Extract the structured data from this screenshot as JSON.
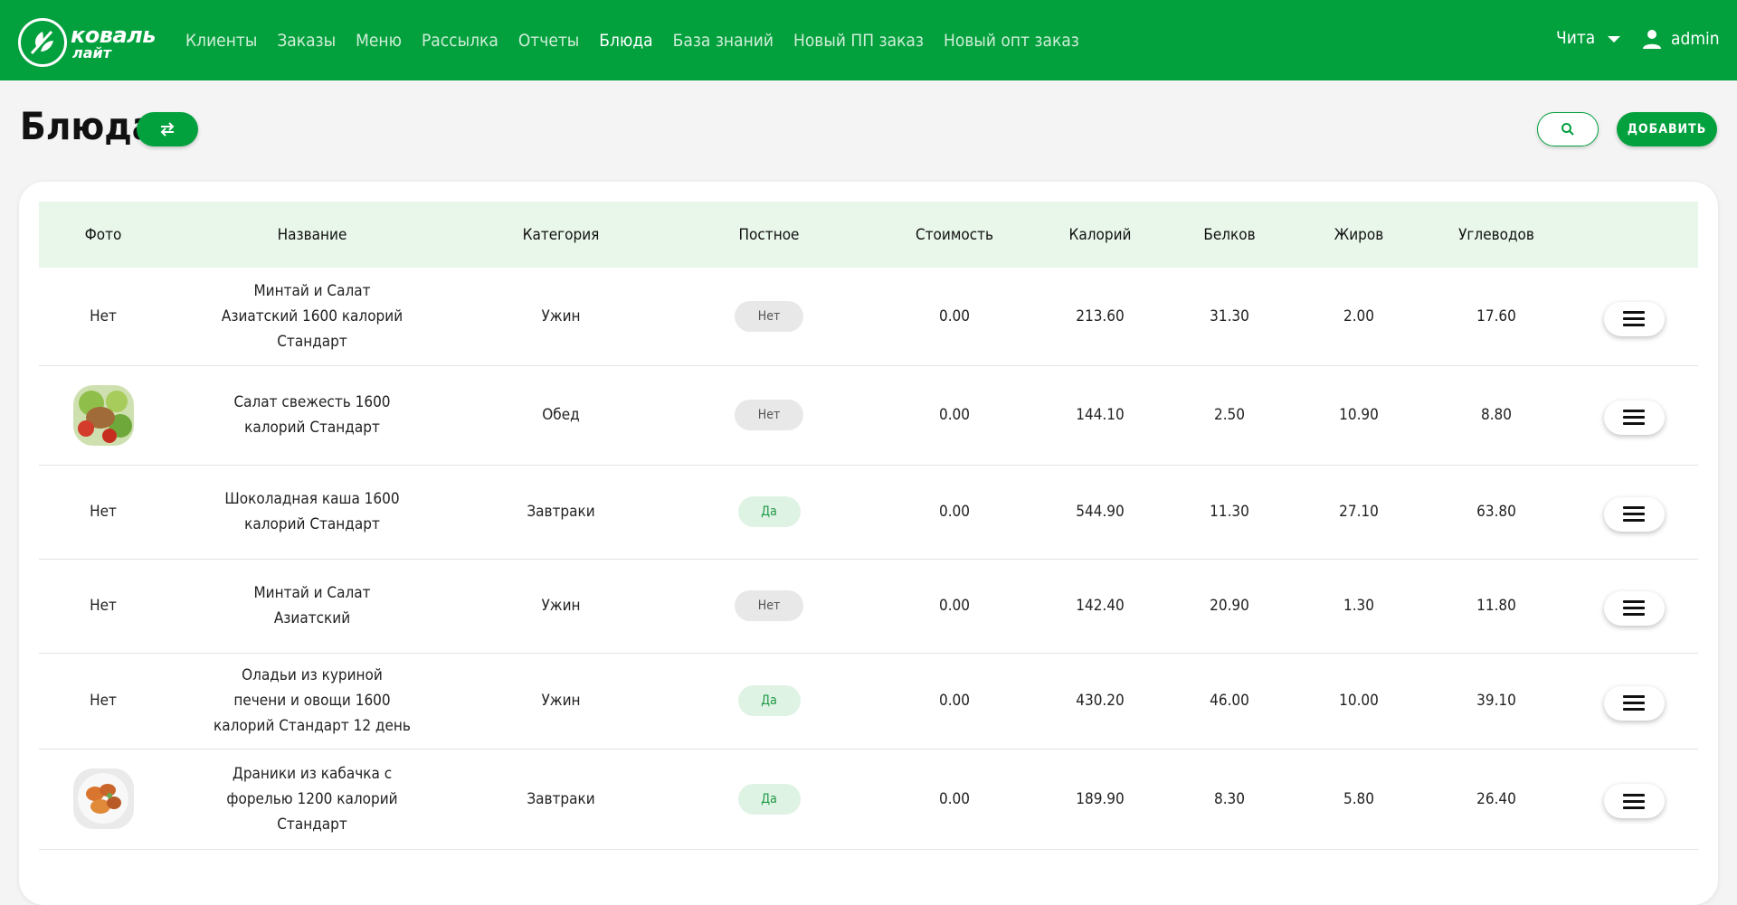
{
  "brand": {
    "line1": "коваль",
    "line2": "лайт"
  },
  "nav": [
    {
      "label": "Клиенты",
      "active": false
    },
    {
      "label": "Заказы",
      "active": false
    },
    {
      "label": "Меню",
      "active": false
    },
    {
      "label": "Рассылка",
      "active": false
    },
    {
      "label": "Отчеты",
      "active": false
    },
    {
      "label": "Блюда",
      "active": true
    },
    {
      "label": "База знаний",
      "active": false
    },
    {
      "label": "Новый ПП заказ",
      "active": false
    },
    {
      "label": "Новый опт заказ",
      "active": false
    }
  ],
  "header": {
    "city": "Чита",
    "user": "admin"
  },
  "page": {
    "title": "Блюда",
    "add_label": "ДОБАВИТЬ"
  },
  "colors": {
    "accent": "#03a03e",
    "header_row": "#e9f6ea"
  },
  "table": {
    "columns": [
      "Фото",
      "Название",
      "Категория",
      "Постное",
      "Стоимость",
      "Калорий",
      "Белков",
      "Жиров",
      "Углеводов",
      ""
    ],
    "rows": [
      {
        "photo": "Нет",
        "name": [
          "Минтай и Салат",
          "Азиатский 1600 калорий",
          "Стандарт"
        ],
        "category": "Ужин",
        "lenten": "Нет",
        "cost": "0.00",
        "calories": "213.60",
        "protein": "31.30",
        "fat": "2.00",
        "carbs": "17.60"
      },
      {
        "photo": "salad-photo",
        "name": [
          "Салат свежесть 1600",
          "калорий Стандарт"
        ],
        "category": "Обед",
        "lenten": "Нет",
        "cost": "0.00",
        "calories": "144.10",
        "protein": "2.50",
        "fat": "10.90",
        "carbs": "8.80"
      },
      {
        "photo": "Нет",
        "name": [
          "Шоколадная каша 1600",
          "калорий Стандарт"
        ],
        "category": "Завтраки",
        "lenten": "Да",
        "cost": "0.00",
        "calories": "544.90",
        "protein": "11.30",
        "fat": "27.10",
        "carbs": "63.80"
      },
      {
        "photo": "Нет",
        "name": [
          "Минтай и Салат",
          "Азиатский"
        ],
        "category": "Ужин",
        "lenten": "Нет",
        "cost": "0.00",
        "calories": "142.40",
        "protein": "20.90",
        "fat": "1.30",
        "carbs": "11.80"
      },
      {
        "photo": "Нет",
        "name": [
          "Оладьи из куриной",
          "печени и овощи 1600",
          "калорий Стандарт 12 день"
        ],
        "category": "Ужин",
        "lenten": "Да",
        "cost": "0.00",
        "calories": "430.20",
        "protein": "46.00",
        "fat": "10.00",
        "carbs": "39.10"
      },
      {
        "photo": "draniki-photo",
        "name": [
          "Драники из кабачка с",
          "форелью 1200 калорий",
          "Стандарт"
        ],
        "category": "Завтраки",
        "lenten": "Да",
        "cost": "0.00",
        "calories": "189.90",
        "protein": "8.30",
        "fat": "5.80",
        "carbs": "26.40"
      }
    ]
  }
}
